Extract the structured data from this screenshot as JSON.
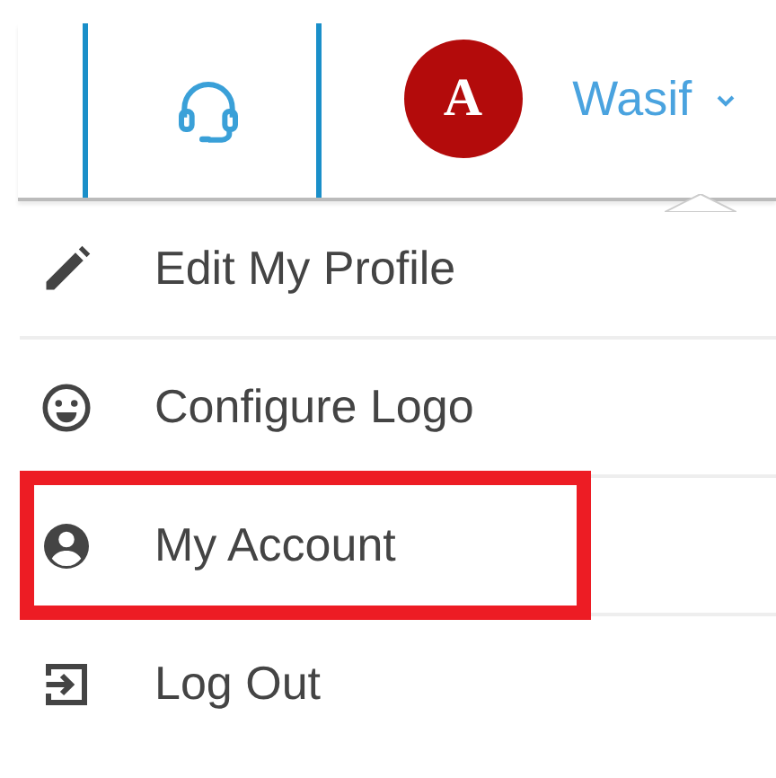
{
  "header": {
    "avatar": {
      "letter": "A"
    },
    "user_name": "Wasif"
  },
  "menu": {
    "items": [
      {
        "label": "Edit My Profile",
        "highlighted": false
      },
      {
        "label": "Configure Logo",
        "highlighted": false
      },
      {
        "label": "My Account",
        "highlighted": true
      },
      {
        "label": "Log Out",
        "highlighted": false
      }
    ]
  }
}
